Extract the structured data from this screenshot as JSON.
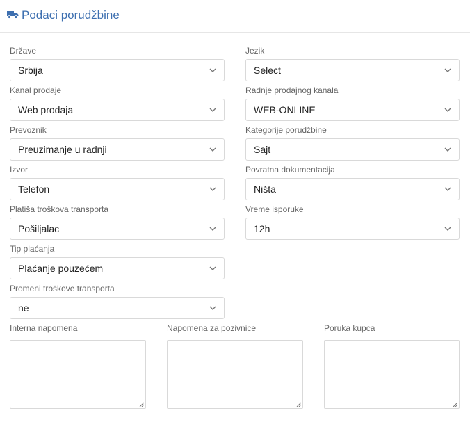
{
  "header": {
    "title": "Podaci porudžbine",
    "icon": "truck-icon",
    "accent": "#3d6fb0"
  },
  "fields": [
    {
      "label": "Države",
      "value": "Srbija"
    },
    {
      "label": "Jezik",
      "value": "Select"
    },
    {
      "label": "Kanal prodaje",
      "value": "Web prodaja"
    },
    {
      "label": "Radnje prodajnog kanala",
      "value": "WEB-ONLINE"
    },
    {
      "label": "Prevoznik",
      "value": "Preuzimanje u radnji"
    },
    {
      "label": "Kategorije porudžbine",
      "value": "Sajt"
    },
    {
      "label": "Izvor",
      "value": "Telefon"
    },
    {
      "label": "Povratna dokumentacija",
      "value": "Ništa"
    },
    {
      "label": "Platiša troškova transporta",
      "value": "Pošiljalac"
    },
    {
      "label": "Vreme isporuke",
      "value": "12h"
    },
    {
      "label": "Tip plaćanja",
      "value": "Plaćanje pouzećem"
    },
    {
      "label": "Promeni troškove transporta",
      "value": "ne"
    }
  ],
  "notes": [
    {
      "label": "Interna napomena",
      "value": ""
    },
    {
      "label": "Napomena za pozivnice",
      "value": ""
    },
    {
      "label": "Poruka kupca",
      "value": ""
    }
  ]
}
